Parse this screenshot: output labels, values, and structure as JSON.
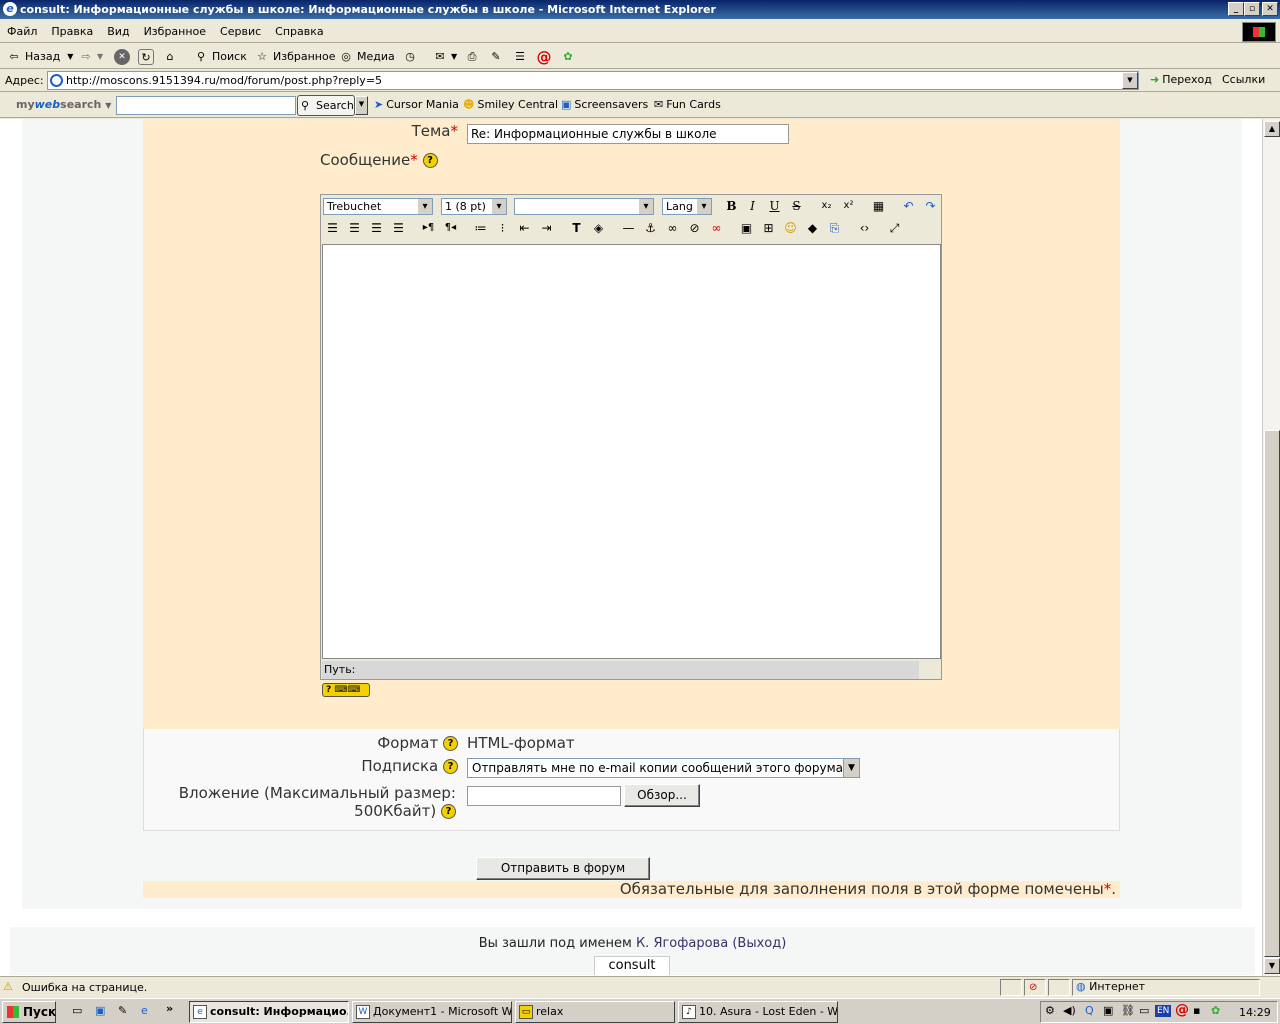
{
  "window": {
    "title": "consult: Информационные службы в школе: Информационные службы в школе - Microsoft Internet Explorer",
    "minimize": "_",
    "restore": "▫",
    "close": "✕"
  },
  "menu": [
    "Файл",
    "Правка",
    "Вид",
    "Избранное",
    "Сервис",
    "Справка"
  ],
  "toolbar": {
    "back": "Назад",
    "search": "Поиск",
    "favorites": "Избранное",
    "media": "Медиа"
  },
  "address": {
    "label": "Адрес:",
    "url": "http://moscons.9151394.ru/mod/forum/post.php?reply=5",
    "go": "Переход",
    "links": "Ссылки"
  },
  "mywebsearch": {
    "logo_prefix": "my",
    "logo_web": "web",
    "logo_suffix": "search",
    "search_button": "Search",
    "items": [
      "Cursor Mania",
      "Smiley Central",
      "Screensavers",
      "Fun Cards"
    ]
  },
  "form": {
    "subject_label": "Тема",
    "subject_value": "Re: Информационные службы в школе",
    "message_label": "Сообщение",
    "required_mark": "*",
    "help_glyph": "?",
    "editor": {
      "font": "Trebuchet",
      "size": "1 (8 pt)",
      "style": "",
      "lang": "Lang",
      "path_label": "Путь:"
    },
    "format_label": "Формат",
    "format_value": "HTML-формат",
    "subscribe_label": "Подписка",
    "subscribe_value": "Отправлять мне по e-mail копии сообщений этого форума",
    "attachment_label_1": "Вложение (Максимальный размер:",
    "attachment_label_2": "500Кбайт)",
    "browse_button": "Обзор...",
    "submit_button": "Отправить в форум",
    "required_note": "Обязательные для заполнения поля в этой форме помечены"
  },
  "footer": {
    "logged_in_prefix": "Вы зашли под именем",
    "user": "К. Ягофарова",
    "logout": "(Выход)",
    "home_link": "consult"
  },
  "status": {
    "message": "Ошибка на странице.",
    "zone": "Интернет"
  },
  "taskbar": {
    "start": "Пуск",
    "tasks": [
      "consult: Информацио...",
      "Документ1 - Microsoft W...",
      "relax",
      "10. Asura - Lost Eden - W..."
    ],
    "lang": "EN",
    "clock": "14:29"
  }
}
